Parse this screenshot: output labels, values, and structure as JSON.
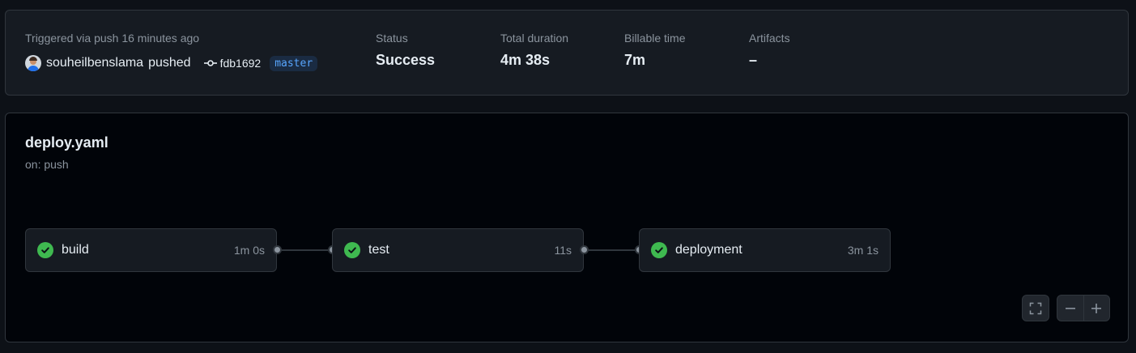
{
  "summary": {
    "trigger_label": "Triggered via push 16 minutes ago",
    "actor": "souheilbenslama",
    "action": "pushed",
    "commit_sha": "fdb1692",
    "branch": "master",
    "status_label": "Status",
    "status_value": "Success",
    "duration_label": "Total duration",
    "duration_value": "4m 38s",
    "billable_label": "Billable time",
    "billable_value": "7m",
    "artifacts_label": "Artifacts",
    "artifacts_value": "–"
  },
  "workflow": {
    "name": "deploy.yaml",
    "trigger": "on: push",
    "jobs": [
      {
        "name": "build",
        "duration": "1m 0s",
        "status": "success"
      },
      {
        "name": "test",
        "duration": "11s",
        "status": "success"
      },
      {
        "name": "deployment",
        "duration": "3m 1s",
        "status": "success"
      }
    ]
  },
  "icons": {
    "fullscreen": "fullscreen-icon",
    "zoom_out": "zoom-out-icon",
    "zoom_in": "zoom-in-icon",
    "check": "check-circle-icon",
    "commit": "git-commit-icon"
  },
  "colors": {
    "success": "#3fb950",
    "branch": "#58a6ff",
    "muted": "#8b949e"
  }
}
